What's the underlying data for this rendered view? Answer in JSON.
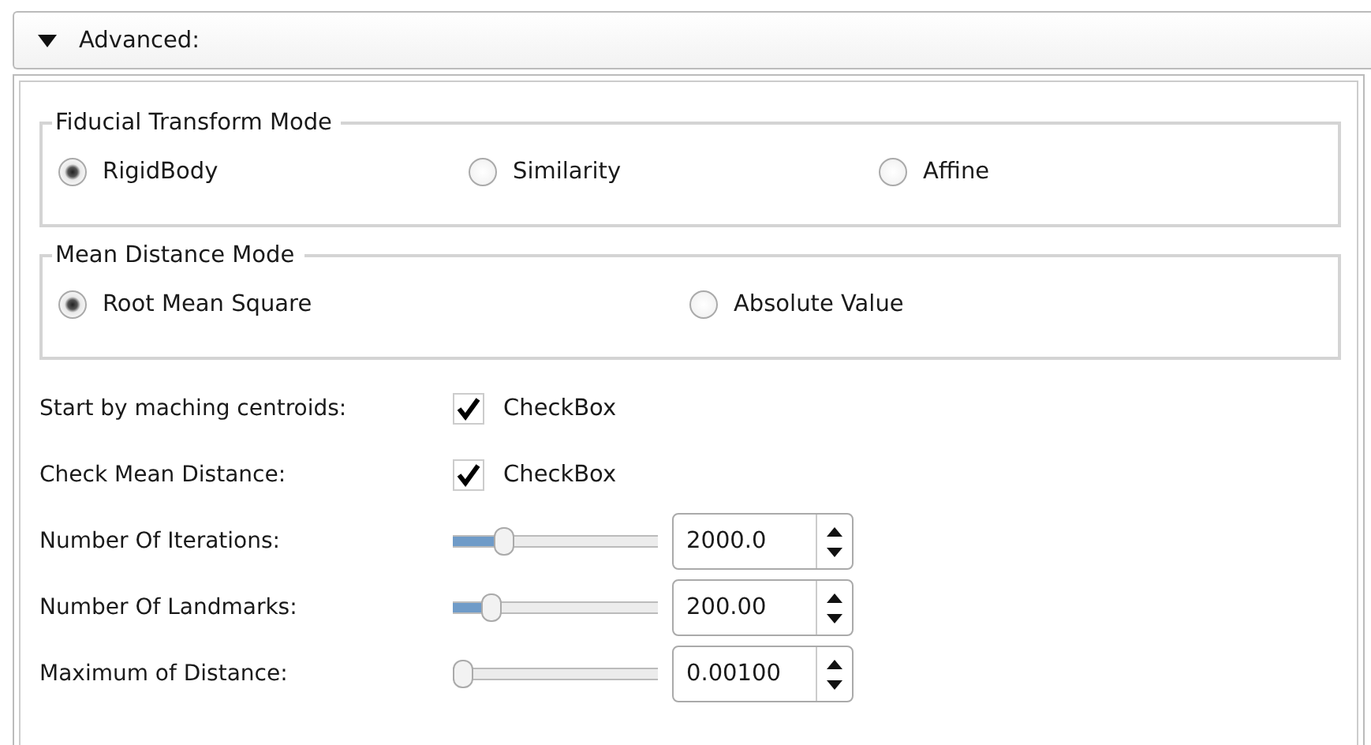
{
  "section": {
    "title": "Advanced:",
    "expanded": true
  },
  "groups": [
    {
      "title": "Fiducial Transform Mode",
      "options": [
        {
          "label": "RigidBody",
          "selected": true
        },
        {
          "label": "Similarity",
          "selected": false
        },
        {
          "label": "Affine",
          "selected": false
        }
      ]
    },
    {
      "title": "Mean Distance Mode",
      "options": [
        {
          "label": "Root Mean Square",
          "selected": true
        },
        {
          "label": "Absolute Value",
          "selected": false
        }
      ]
    }
  ],
  "fields": [
    {
      "kind": "checkbox",
      "label": "Start by maching centroids:",
      "text": "CheckBox",
      "checked": true
    },
    {
      "kind": "checkbox",
      "label": "Check Mean Distance:",
      "text": "CheckBox",
      "checked": true
    },
    {
      "kind": "slider",
      "label": "Number Of Iterations:",
      "level": 0.22,
      "value": "2000.0"
    },
    {
      "kind": "slider",
      "label": "Number Of Landmarks:",
      "level": 0.15,
      "value": "200.00"
    },
    {
      "kind": "slider",
      "label": "Maximum of Distance:",
      "level": 0.0,
      "value": "0.00100"
    }
  ]
}
